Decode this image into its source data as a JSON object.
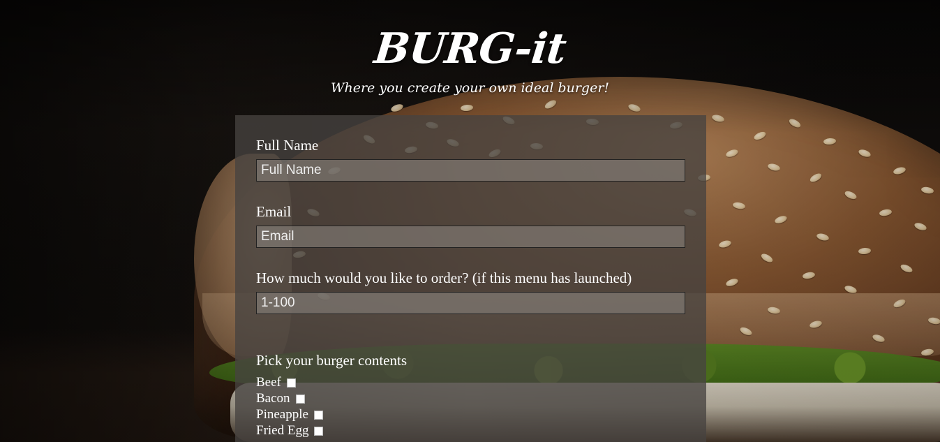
{
  "header": {
    "title": "BURG-it",
    "tagline": "Where you create your own ideal burger!"
  },
  "form": {
    "fields": [
      {
        "label": "Full Name",
        "placeholder": "Full Name"
      },
      {
        "label": "Email",
        "placeholder": "Email"
      },
      {
        "label": "How much would you like to order? (if this menu has launched)",
        "placeholder": "1-100"
      }
    ],
    "contents_heading": "Pick your burger contents",
    "contents_options": [
      {
        "label": "Beef",
        "checked": false
      },
      {
        "label": "Bacon",
        "checked": false
      },
      {
        "label": "Pineapple",
        "checked": false
      },
      {
        "label": "Fried Egg",
        "checked": false
      }
    ]
  },
  "colors": {
    "panel": "#464240",
    "text": "#ffffff",
    "input_bg": "#8c8682"
  },
  "icons": {
    "checkbox": "checkbox-icon"
  }
}
